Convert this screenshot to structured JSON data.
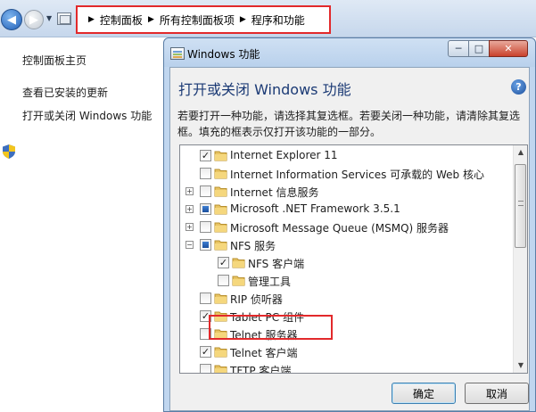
{
  "breadcrumb": {
    "segments": [
      "控制面板",
      "所有控制面板项",
      "程序和功能"
    ]
  },
  "left_pane": {
    "links": [
      "控制面板主页",
      "查看已安装的更新",
      "打开或关闭 Windows 功能"
    ]
  },
  "dialog": {
    "title": "Windows 功能",
    "heading": "打开或关闭 Windows 功能",
    "help": "?",
    "description": "若要打开一种功能，请选择其复选框。若要关闭一种功能，请清除其复选框。填充的框表示仅打开该功能的一部分。",
    "caption": {
      "minimize": "─",
      "maximize": "□",
      "close": "✕"
    },
    "features": [
      {
        "label": "Internet Explorer 11",
        "state": "checked",
        "expander": "",
        "level": 0
      },
      {
        "label": "Internet Information Services 可承载的 Web 核心",
        "state": "unchecked",
        "expander": "",
        "level": 0
      },
      {
        "label": "Internet 信息服务",
        "state": "unchecked",
        "expander": "+",
        "level": 0
      },
      {
        "label": "Microsoft .NET Framework 3.5.1",
        "state": "partial",
        "expander": "+",
        "level": 0
      },
      {
        "label": "Microsoft Message Queue (MSMQ) 服务器",
        "state": "unchecked",
        "expander": "+",
        "level": 0
      },
      {
        "label": "NFS 服务",
        "state": "partial",
        "expander": "−",
        "level": 0
      },
      {
        "label": "NFS 客户端",
        "state": "checked",
        "expander": "",
        "level": 1
      },
      {
        "label": "管理工具",
        "state": "unchecked",
        "expander": "",
        "level": 1
      },
      {
        "label": "RIP 侦听器",
        "state": "unchecked",
        "expander": "",
        "level": 0
      },
      {
        "label": "Tablet PC 组件",
        "state": "checked",
        "expander": "",
        "level": 0
      },
      {
        "label": "Telnet 服务器",
        "state": "unchecked",
        "expander": "",
        "level": 0
      },
      {
        "label": "Telnet 客户端",
        "state": "checked",
        "expander": "",
        "level": 0
      },
      {
        "label": "TFTP 客户端",
        "state": "unchecked",
        "expander": "",
        "level": 0
      }
    ],
    "buttons": {
      "ok": "确定",
      "cancel": "取消"
    }
  }
}
